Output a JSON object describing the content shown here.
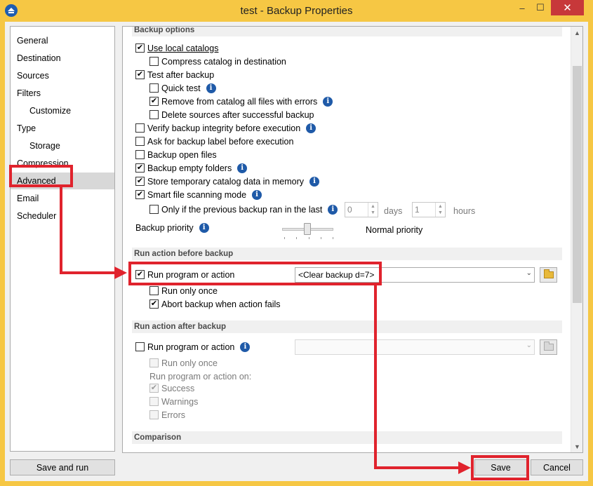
{
  "window": {
    "title": "test - Backup Properties",
    "minimize": "–",
    "maximize": "☐",
    "close": "✕"
  },
  "nav": {
    "items": [
      {
        "label": "General"
      },
      {
        "label": "Destination"
      },
      {
        "label": "Sources"
      },
      {
        "label": "Filters"
      },
      {
        "label": "Customize"
      },
      {
        "label": "Type"
      },
      {
        "label": "Storage"
      },
      {
        "label": "Compression"
      },
      {
        "label": "Advanced"
      },
      {
        "label": "Email"
      },
      {
        "label": "Scheduler"
      }
    ]
  },
  "backup_options": {
    "header": "Backup options",
    "use_local_catalogs": "Use local catalogs",
    "compress_catalog": "Compress catalog in destination",
    "test_after_backup": "Test after backup",
    "quick_test": "Quick test",
    "remove_from_catalog": "Remove from catalog all files with errors",
    "delete_sources": "Delete sources after successful backup",
    "verify_integrity": "Verify backup integrity before execution",
    "ask_label": "Ask for backup label before execution",
    "backup_open_files": "Backup open files",
    "backup_empty_folders": "Backup empty folders",
    "store_temp_catalog": "Store temporary catalog data in memory",
    "smart_scanning": "Smart file scanning mode",
    "only_if_previous": "Only if the previous backup ran in the last",
    "days_value": "0",
    "days_label": "days",
    "hours_value": "1",
    "hours_label": "hours",
    "priority_label": "Backup priority",
    "priority_value": "Normal priority"
  },
  "run_before": {
    "header": "Run action before backup",
    "run_program": "Run program or action",
    "program_value": "<Clear backup d=7>",
    "run_only_once": "Run only once",
    "abort_on_fail": "Abort backup when action fails"
  },
  "run_after": {
    "header": "Run action after backup",
    "run_program": "Run program or action",
    "run_only_once": "Run only once",
    "run_on_label": "Run program or action on:",
    "success": "Success",
    "warnings": "Warnings",
    "errors": "Errors"
  },
  "comparison": {
    "header": "Comparison"
  },
  "footer": {
    "save_and_run": "Save and run",
    "save": "Save",
    "cancel": "Cancel"
  },
  "colors": {
    "highlight": "#e0232d",
    "titlebar": "#f6c744",
    "info_icon": "#1f5aa8",
    "close_button": "#c7383a"
  }
}
